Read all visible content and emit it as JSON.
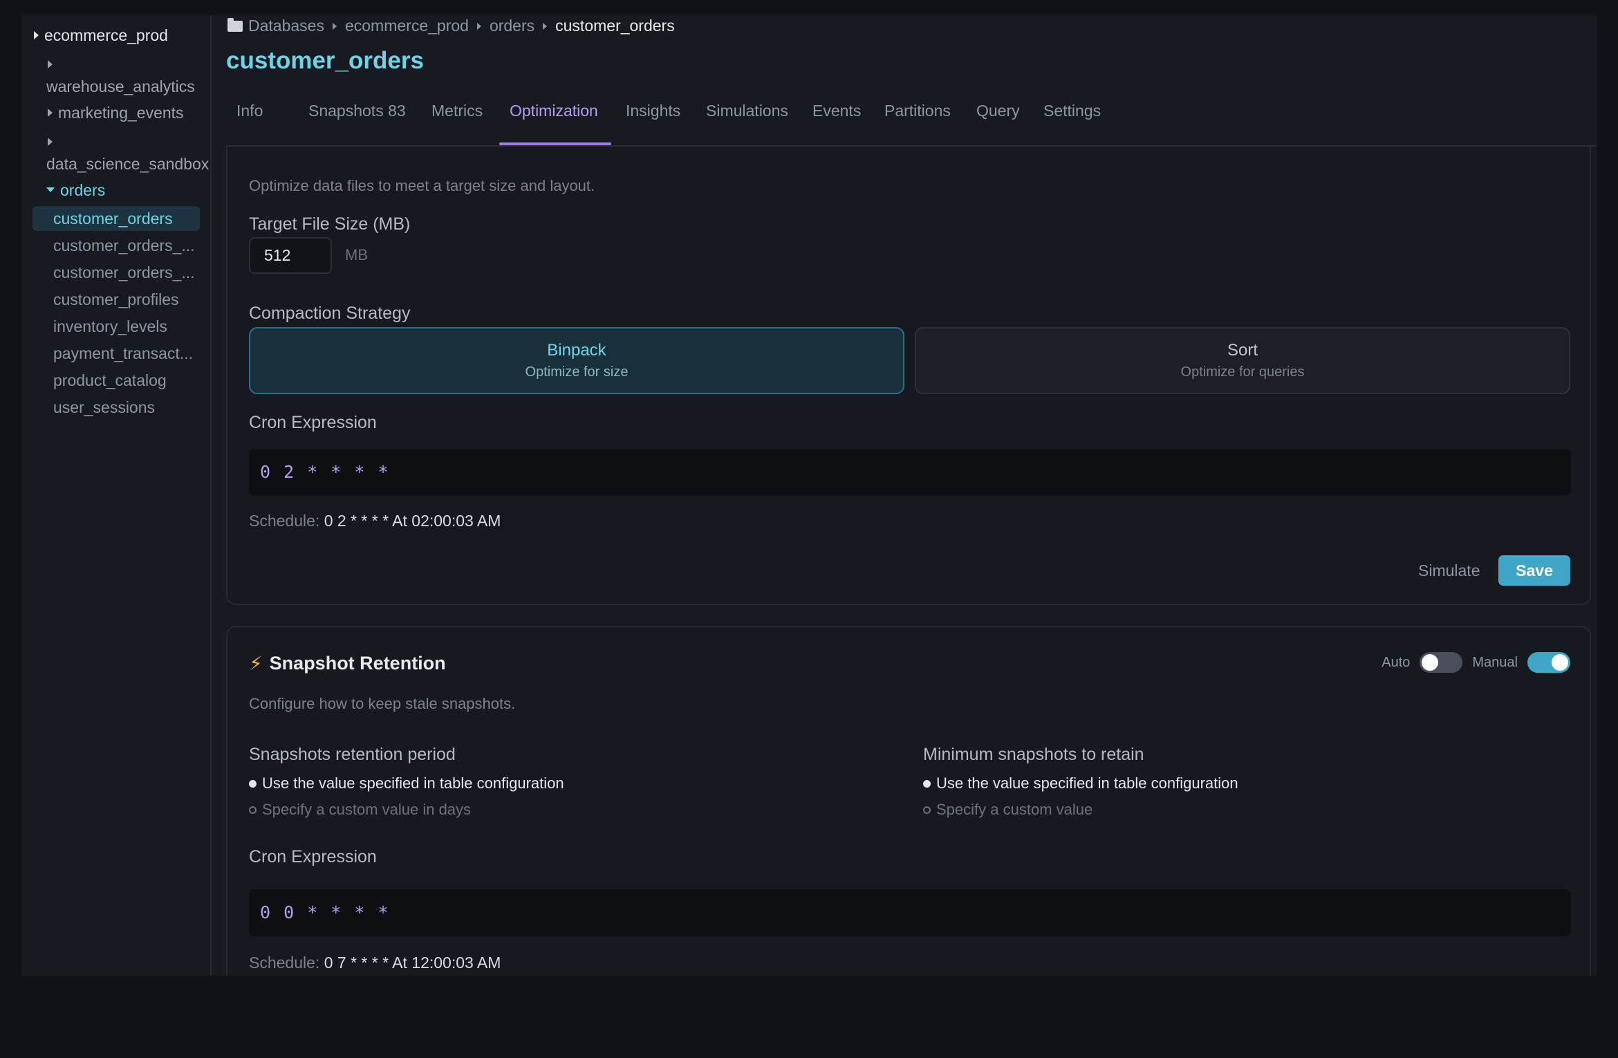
{
  "sidebar": {
    "root": "ecommerce_prod",
    "databases": [
      "warehouse_analytics",
      "marketing_events",
      "data_science_sandbox",
      "orders"
    ],
    "tables": [
      "customer_orders",
      "customer_orders_...",
      "customer_orders_...",
      "customer_profiles",
      "inventory_levels",
      "payment_transact...",
      "product_catalog",
      "user_sessions"
    ]
  },
  "breadcrumb": [
    "Databases",
    "ecommerce_prod",
    "orders",
    "customer_orders"
  ],
  "title": "customer_orders",
  "tabs": [
    "Info",
    "Snapshots 83",
    "Metrics",
    "Optimization",
    "Insights",
    "Simulations",
    "Events",
    "Partitions",
    "Query",
    "Settings"
  ],
  "active_tab": "Optimization",
  "optimization": {
    "description": "Optimize data files to meet a target size and layout.",
    "target_label": "Target File Size (MB)",
    "target_value": "512",
    "target_unit": "MB",
    "strategy_label": "Compaction Strategy",
    "strategies": [
      {
        "title": "Binpack",
        "subtitle": "Optimize for size",
        "selected": true
      },
      {
        "title": "Sort",
        "subtitle": "Optimize for queries",
        "selected": false
      }
    ],
    "cron_label": "Cron Expression",
    "cron_value": "0 2 * * * *",
    "schedule_label": "Schedule:",
    "schedule_value": "0 2 * * * * At 02:00:03 AM",
    "simulate_label": "Simulate",
    "save_label": "Save"
  },
  "retention": {
    "title": "Snapshot Retention",
    "auto_label": "Auto",
    "auto_on": false,
    "manual_label": "Manual",
    "manual_on": true,
    "description": "Configure how to keep stale snapshots.",
    "period_title": "Snapshots retention period",
    "period_options": [
      "Use the value specified in table configuration",
      "Specify a custom value in days"
    ],
    "min_title": "Minimum snapshots to retain",
    "min_options": [
      "Use the value specified in table configuration",
      "Specify a custom value"
    ],
    "cron_label": "Cron Expression",
    "cron_value": "0 0 * * * *",
    "schedule_label": "Schedule:",
    "schedule_value": "0 7 * * * * At 12:00:03 AM"
  },
  "colors": {
    "accent": "#6fd3e6",
    "tab_active": "#9b7be0",
    "save_button": "#3fa6c7"
  }
}
